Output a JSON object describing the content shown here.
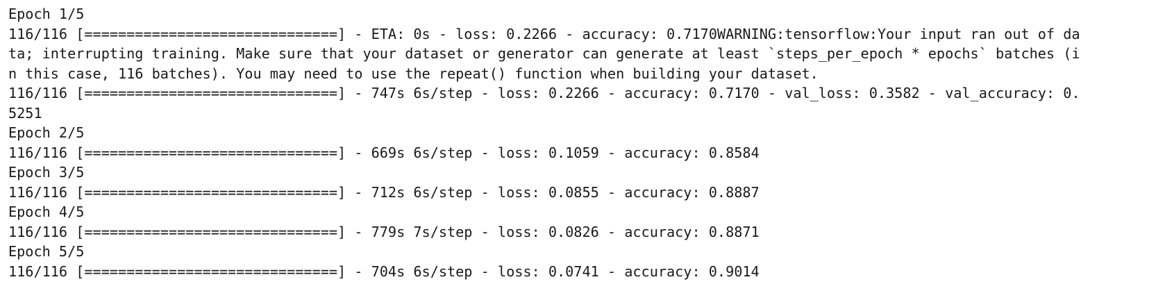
{
  "console": {
    "lines": [
      "Epoch 1/5",
      "116/116 [==============================] - ETA: 0s - loss: 0.2266 - accuracy: 0.7170WARNING:tensorflow:Your input ran out of da",
      "ta; interrupting training. Make sure that your dataset or generator can generate at least `steps_per_epoch * epochs` batches (i",
      "n this case, 116 batches). You may need to use the repeat() function when building your dataset.",
      "116/116 [==============================] - 747s 6s/step - loss: 0.2266 - accuracy: 0.7170 - val_loss: 0.3582 - val_accuracy: 0.",
      "5251",
      "Epoch 2/5",
      "116/116 [==============================] - 669s 6s/step - loss: 0.1059 - accuracy: 0.8584",
      "Epoch 3/5",
      "116/116 [==============================] - 712s 6s/step - loss: 0.0855 - accuracy: 0.8887",
      "Epoch 4/5",
      "116/116 [==============================] - 779s 7s/step - loss: 0.0826 - accuracy: 0.8871",
      "Epoch 5/5",
      "116/116 [==============================] - 704s 6s/step - loss: 0.0741 - accuracy: 0.9014"
    ]
  }
}
